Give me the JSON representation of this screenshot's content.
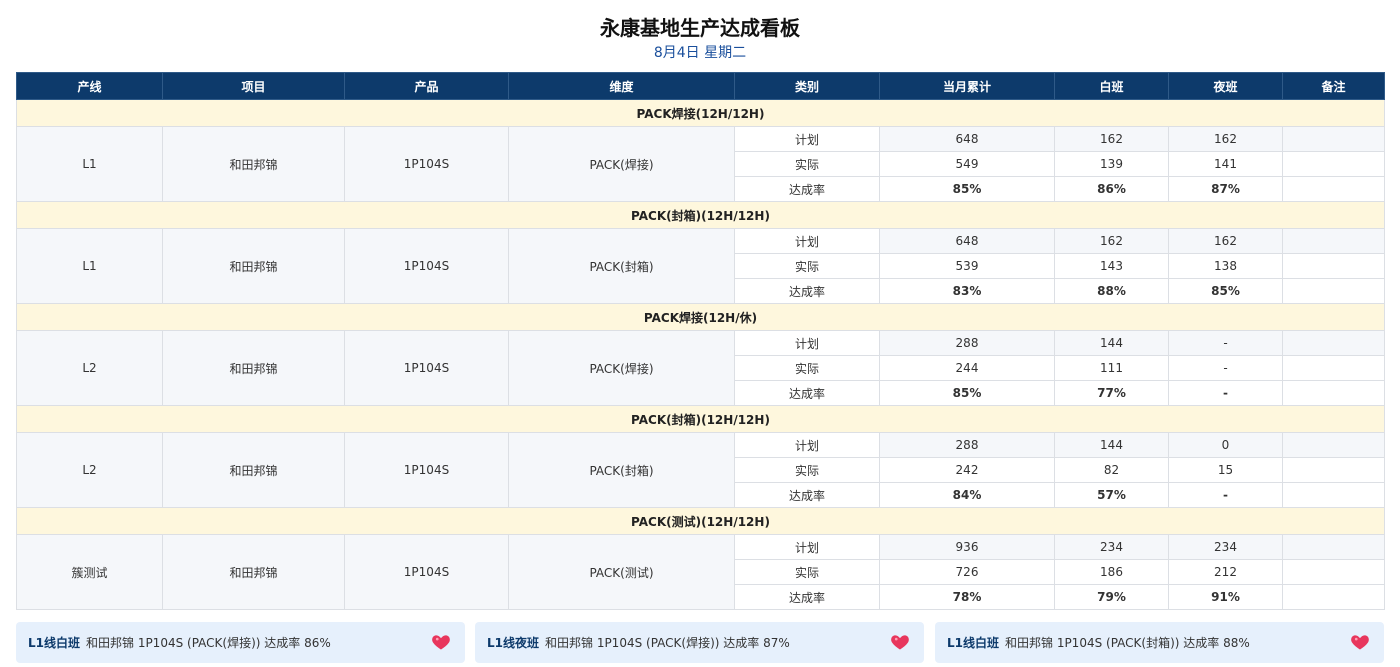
{
  "title": "永康基地生产达成看板",
  "subtitle": "8月4日 星期二",
  "colors": {
    "header_bg": "#0d3a6b",
    "section_bg": "#fef7dd",
    "rate_red": "#c00000",
    "card_bg": "#e6f0fc"
  },
  "headers": [
    "产线",
    "项目",
    "产品",
    "维度",
    "类别",
    "当月累计",
    "白班",
    "夜班",
    "备注"
  ],
  "sections": [
    {
      "label": "PACK焊接(12H/12H)",
      "line": "L1",
      "project": "和田邦锦",
      "product": "1P104S",
      "dimension": "PACK(焊接)",
      "rows": [
        {
          "cat": "计划",
          "month": "648",
          "day": "162",
          "night": "162",
          "note": ""
        },
        {
          "cat": "实际",
          "month": "549",
          "day": "139",
          "night": "141",
          "note": ""
        },
        {
          "cat": "达成率",
          "month": "85%",
          "day": "86%",
          "night": "87%",
          "note": ""
        }
      ]
    },
    {
      "label": "PACK(封箱)(12H/12H)",
      "line": "L1",
      "project": "和田邦锦",
      "product": "1P104S",
      "dimension": "PACK(封箱)",
      "rows": [
        {
          "cat": "计划",
          "month": "648",
          "day": "162",
          "night": "162",
          "note": ""
        },
        {
          "cat": "实际",
          "month": "539",
          "day": "143",
          "night": "138",
          "note": ""
        },
        {
          "cat": "达成率",
          "month": "83%",
          "day": "88%",
          "night": "85%",
          "note": ""
        }
      ]
    },
    {
      "label": "PACK焊接(12H/休)",
      "line": "L2",
      "project": "和田邦锦",
      "product": "1P104S",
      "dimension": "PACK(焊接)",
      "rows": [
        {
          "cat": "计划",
          "month": "288",
          "day": "144",
          "night": "-",
          "note": ""
        },
        {
          "cat": "实际",
          "month": "244",
          "day": "111",
          "night": "-",
          "note": ""
        },
        {
          "cat": "达成率",
          "month": "85%",
          "day": "77%",
          "night": "-",
          "note": ""
        }
      ]
    },
    {
      "label": "PACK(封箱)(12H/12H)",
      "line": "L2",
      "project": "和田邦锦",
      "product": "1P104S",
      "dimension": "PACK(封箱)",
      "rows": [
        {
          "cat": "计划",
          "month": "288",
          "day": "144",
          "night": "0",
          "note": ""
        },
        {
          "cat": "实际",
          "month": "242",
          "day": "82",
          "night": "15",
          "note": ""
        },
        {
          "cat": "达成率",
          "month": "84%",
          "day": "57%",
          "night": "-",
          "note": ""
        }
      ]
    },
    {
      "label": "PACK(测试)(12H/12H)",
      "line": "簇测试",
      "project": "和田邦锦",
      "product": "1P104S",
      "dimension": "PACK(测试)",
      "rows": [
        {
          "cat": "计划",
          "month": "936",
          "day": "234",
          "night": "234",
          "note": ""
        },
        {
          "cat": "实际",
          "month": "726",
          "day": "186",
          "night": "212",
          "note": ""
        },
        {
          "cat": "达成率",
          "month": "78%",
          "day": "79%",
          "night": "91%",
          "note": ""
        }
      ]
    }
  ],
  "cards": [
    {
      "who": "L1线白班",
      "text": "和田邦锦 1P104S (PACK(焊接)) 达成率 86%",
      "icon": "heart-icon"
    },
    {
      "who": "L1线夜班",
      "text": "和田邦锦 1P104S (PACK(焊接)) 达成率 87%",
      "icon": "heart-icon"
    },
    {
      "who": "L1线白班",
      "text": "和田邦锦 1P104S (PACK(封箱)) 达成率 88%",
      "icon": "heart-icon"
    }
  ]
}
